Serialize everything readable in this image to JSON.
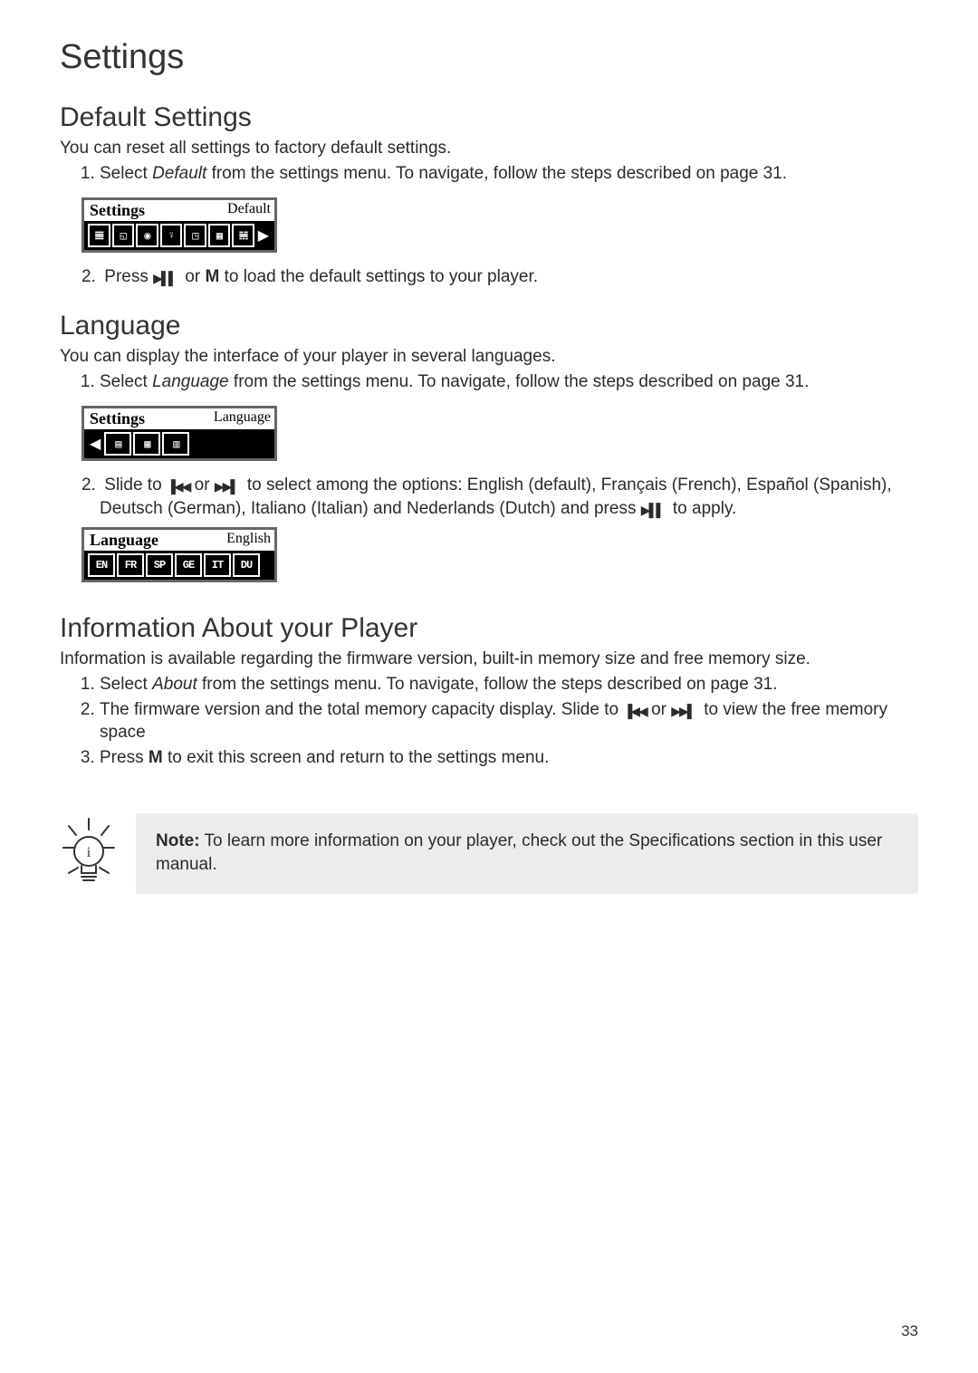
{
  "page_title": "Settings",
  "page_number": "33",
  "default": {
    "heading": "Default Settings",
    "intro": "You can reset all settings to factory default settings.",
    "step1_pre": "Select ",
    "step1_italic": "Default",
    "step1_post": " from the settings menu. To navigate, follow the steps described on page 31.",
    "lcd_tab": "Settings",
    "lcd_label": "Default",
    "step2_pre": "Press ",
    "step2_mid": " or ",
    "step2_m": "M",
    "step2_post": " to load the default settings to your player."
  },
  "language": {
    "heading": "Language",
    "intro": "You can display the interface of your player in several languages.",
    "step1_pre": "Select ",
    "step1_italic": "Language",
    "step1_post": " from the settings menu. To navigate, follow the steps described on page 31.",
    "lcd1_tab": "Settings",
    "lcd1_label": "Language",
    "step2_pre": "Slide to ",
    "step2_mid1": " or ",
    "step2_mid2": " to select among the options: English (default), Français (French), Español (Spanish), Deutsch (German), Italiano (Italian) and Nederlands (Dutch) and press ",
    "step2_post": " to apply.",
    "lcd2_tab": "Language",
    "lcd2_label": "English",
    "lang_codes": [
      "EN",
      "FR",
      "SP",
      "GE",
      "IT",
      "DU"
    ]
  },
  "about": {
    "heading": "Information About your Player",
    "intro": "Information is available regarding the firmware version, built-in memory size and free memory size.",
    "step1_pre": "Select ",
    "step1_italic": "About",
    "step1_post": " from the settings menu. To navigate, follow the steps described on page 31.",
    "step2_pre": "The firmware version and the total memory capacity display. Slide to ",
    "step2_mid": " or ",
    "step2_post": " to view the free memory space",
    "step3_pre": "Press ",
    "step3_m": "M",
    "step3_post": " to exit this screen and return to the settings menu."
  },
  "note": {
    "label": "Note:",
    "text": " To learn more information on your player, check out the Specifications section in this user manual."
  },
  "icons": {
    "play_pause": "▶▌▌",
    "prev": "▐◀◀",
    "next": "▶▶▌"
  }
}
